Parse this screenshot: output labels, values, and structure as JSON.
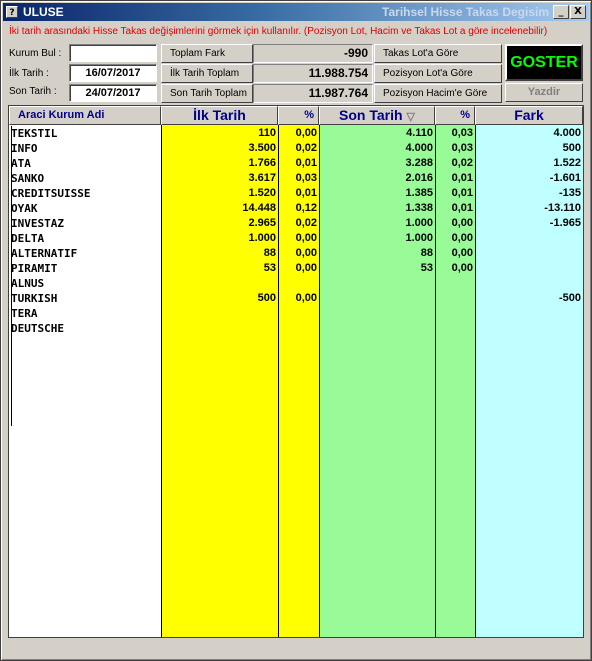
{
  "window": {
    "app_name": "ULUSE",
    "caption": "Tarihsel Hisse Takas Degisim",
    "minimize_glyph": "_",
    "close_glyph": "X",
    "app_icon_glyph": "?"
  },
  "info_text": "İki tarih arasındaki Hisse Takas değişimlerini görmek için kullanılır. (Pozisyon Lot, Hacim ve Takas Lot a göre incelenebilir)",
  "form": {
    "kurum_bul_label": "Kurum Bul :",
    "kurum_bul_value": "",
    "ilk_tarih_label": "İlk Tarih    :",
    "ilk_tarih_value": "16/07/2017",
    "son_tarih_label": "Son Tarih   :",
    "son_tarih_value": "24/07/2017"
  },
  "summary": {
    "toplam_fark_label": "Toplam Fark",
    "toplam_fark_value": "-990",
    "ilk_tarih_toplam_label": "İlk Tarih Toplam",
    "ilk_tarih_toplam_value": "11.988.754",
    "son_tarih_toplam_label": "Son Tarih Toplam",
    "son_tarih_toplam_value": "11.987.764"
  },
  "options": {
    "takas_lot": "Takas Lot'a Göre",
    "pozisyon_lot": "Pozisyon Lot'a Göre",
    "pozisyon_hacim": "Pozisyon Hacim'e Göre"
  },
  "buttons": {
    "goster": "GOSTER",
    "yazdir": "Yazdir"
  },
  "colors": {
    "ilk_col": "#ffff00",
    "son_col": "#98fb98",
    "fark_col": "#c0ffff",
    "goster_text": "#00ff00",
    "info_text": "#e00000"
  },
  "table": {
    "headers": {
      "name": "Araci Kurum Adi",
      "ilk": "İlk Tarih",
      "ilk_pct": "%",
      "son": "Son Tarih",
      "son_pct": "%",
      "fark": "Fark"
    },
    "sort_icon": "sort-descending-icon",
    "rows": [
      {
        "name": "TEKSTIL",
        "ilk": "110",
        "ilk_pct": "0,00",
        "son": "4.110",
        "son_pct": "0,03",
        "fark": "4.000"
      },
      {
        "name": "INFO",
        "ilk": "3.500",
        "ilk_pct": "0,02",
        "son": "4.000",
        "son_pct": "0,03",
        "fark": "500"
      },
      {
        "name": "ATA",
        "ilk": "1.766",
        "ilk_pct": "0,01",
        "son": "3.288",
        "son_pct": "0,02",
        "fark": "1.522"
      },
      {
        "name": "SANKO",
        "ilk": "3.617",
        "ilk_pct": "0,03",
        "son": "2.016",
        "son_pct": "0,01",
        "fark": "-1.601"
      },
      {
        "name": "CREDITSUISSE",
        "ilk": "1.520",
        "ilk_pct": "0,01",
        "son": "1.385",
        "son_pct": "0,01",
        "fark": "-135"
      },
      {
        "name": "OYAK",
        "ilk": "14.448",
        "ilk_pct": "0,12",
        "son": "1.338",
        "son_pct": "0,01",
        "fark": "-13.110"
      },
      {
        "name": "INVESTAZ",
        "ilk": "2.965",
        "ilk_pct": "0,02",
        "son": "1.000",
        "son_pct": "0,00",
        "fark": "-1.965"
      },
      {
        "name": "DELTA",
        "ilk": "1.000",
        "ilk_pct": "0,00",
        "son": "1.000",
        "son_pct": "0,00",
        "fark": ""
      },
      {
        "name": "ALTERNATIF",
        "ilk": "88",
        "ilk_pct": "0,00",
        "son": "88",
        "son_pct": "0,00",
        "fark": ""
      },
      {
        "name": "PIRAMIT",
        "ilk": "53",
        "ilk_pct": "0,00",
        "son": "53",
        "son_pct": "0,00",
        "fark": ""
      },
      {
        "name": "ALNUS",
        "ilk": "",
        "ilk_pct": "",
        "son": "",
        "son_pct": "",
        "fark": ""
      },
      {
        "name": "TURKISH",
        "ilk": "500",
        "ilk_pct": "0,00",
        "son": "",
        "son_pct": "",
        "fark": "-500"
      },
      {
        "name": "TERA",
        "ilk": "",
        "ilk_pct": "",
        "son": "",
        "son_pct": "",
        "fark": ""
      },
      {
        "name": "DEUTSCHE",
        "ilk": "",
        "ilk_pct": "",
        "son": "",
        "son_pct": "",
        "fark": ""
      }
    ]
  }
}
